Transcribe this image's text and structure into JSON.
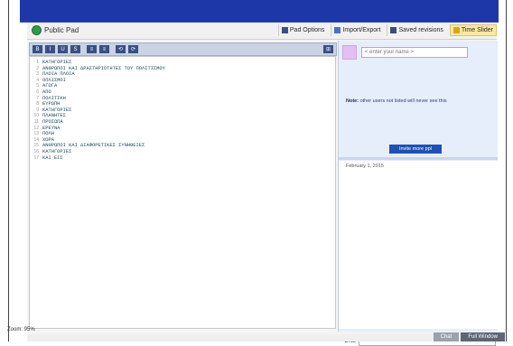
{
  "header": {
    "title": "Public Pad",
    "buttons": [
      {
        "label": "Pad Options",
        "icon": "pad-options-icon"
      },
      {
        "label": "Import/Export",
        "icon": "import-export-icon"
      },
      {
        "label": "Saved revisions",
        "icon": "saved-revisions-icon"
      },
      {
        "label": "Time Slider",
        "icon": "time-slider-icon",
        "active": true
      }
    ]
  },
  "toolbar": {
    "buttons": [
      "B",
      "I",
      "U",
      "S",
      "≡",
      "≡",
      "⟲",
      "⟳"
    ],
    "right_button": "⊞"
  },
  "editor": {
    "lines": [
      "ΚΑΤΗΓΟΡΙΕΣ",
      "ΑΝΘΡΩΠΟΙ ΚΑΙ ΔΡΑΣΤΗΡΙΟΤΗΤΕΣ ΤΟΥ ΠΟΛΙΤΙΣΜΟΥ",
      "ΠΛΟΙΑ ΠΛΟΙΑ",
      "ΟΠΛΙΣΜΟΙ",
      "ΑΓΩΓΑ",
      "ΑΠΟ",
      "ΠΟΛΙΤΙΚΗ",
      "ΕΥΡΩΠΗ",
      "ΚΑΤΗΓΟΡΙΕΣ",
      "ΠΛΑΝΗΤΕΣ",
      "ΠΡΟΣΩΠΑ",
      "ΕΡΕΥΝΑ",
      "ΠΟΛΗ",
      "ΧΩΡΑ",
      "ΑΝΘΡΩΠΟΙ ΚΑΙ ΔΙΑΦΟΡΕΤΙΚΕΣ ΣΥΝΗΘΕΙΕΣ",
      "ΚΑΤΗΓΟΡΙΕΣ",
      "ΚΑΙ ΕΙΣ"
    ]
  },
  "sidebar": {
    "name_placeholder": "< enter your name >",
    "note_bold": "Note:",
    "note_text": "other users not listed will never see this",
    "invite_label": "Invite more ppl",
    "date": "February 1, 2015",
    "chat_label": "Chat"
  },
  "status": {
    "zoom": "Zoom: 95%",
    "btn1": "Chat",
    "btn2": "Full Window"
  }
}
